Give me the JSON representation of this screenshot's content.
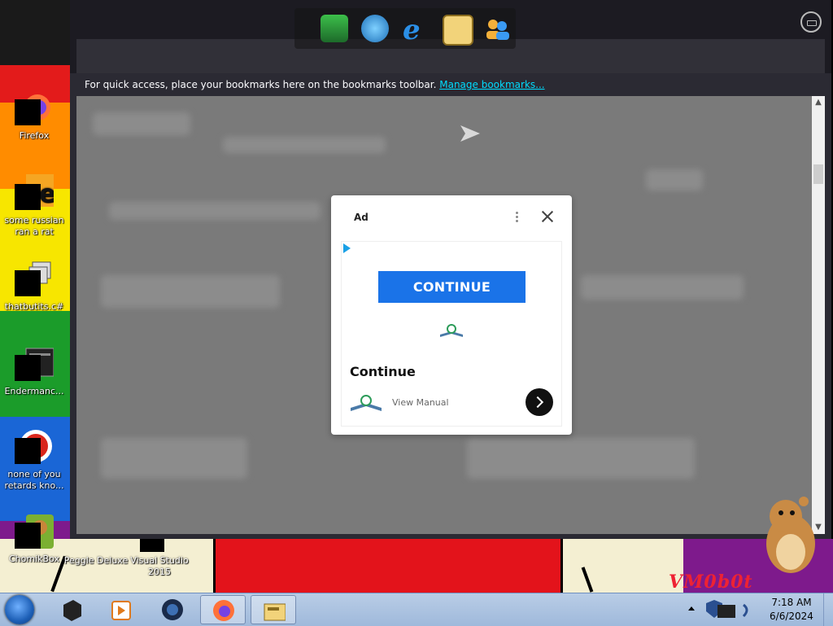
{
  "desktop": {
    "icons": [
      {
        "label": "Firefox"
      },
      {
        "label": "some russian ran a rat"
      },
      {
        "label": "thatbutits.c#"
      },
      {
        "label": "Endermanc..."
      },
      {
        "label": "none of you retards kno..."
      },
      {
        "label": "ChomikBox"
      },
      {
        "label": "Peggle Deluxe"
      },
      {
        "label": "Visual Studio 2015"
      }
    ],
    "watermark": "VM0b0t",
    "stripe_colors": [
      "#e31b1b",
      "#ff8c00",
      "#f7e600",
      "#1b9c2a",
      "#1a66d6",
      "#7e1a8c"
    ]
  },
  "browser": {
    "bookmarks_bar": {
      "text": "For quick access, place your bookmarks here on the bookmarks toolbar.",
      "link": "Manage bookmarks..."
    }
  },
  "quicklaunch": {
    "icons": [
      "cube-app-icon",
      "globe-download-icon",
      "internet-explorer-icon",
      "folder-window-icon",
      "users-icon"
    ]
  },
  "ad": {
    "label": "Ad",
    "cta": "CONTINUE",
    "title": "Continue",
    "subtitle": "View Manual",
    "accent_color": "#1a73e8"
  },
  "taskbar": {
    "items": [
      "cube-app-icon",
      "media-player-icon",
      "gem-app-icon",
      "firefox-icon",
      "folder-window-icon"
    ],
    "clock": {
      "time": "7:18 AM",
      "date": "6/6/2024"
    }
  }
}
